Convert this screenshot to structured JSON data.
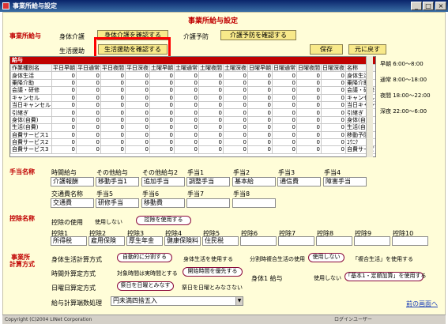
{
  "window": {
    "title": "事業所給与設定"
  },
  "header": {
    "title": "事業所給与設定"
  },
  "kyuyo": {
    "label": "事業所給与",
    "shintai_label": "身体介護",
    "shintai_btn": "身体介護を確認する",
    "kaigo_yobou_label": "介護予防",
    "kaigo_yobou_btn": "介護予防を確認する",
    "seikatsu_label": "生活援助",
    "seikatsu_btn": "生活援助を確認する",
    "save_btn": "保存",
    "restore_btn": "元に戻す"
  },
  "grid": {
    "section_label": "給与",
    "columns": [
      "作業種別名",
      "平日早朝",
      "平日通常",
      "平日夜間",
      "平日深夜",
      "土曜早朝",
      "土曜通常",
      "土曜夜間",
      "土曜深夜",
      "日曜早朝",
      "日曜通常",
      "日曜夜間",
      "日曜深夜",
      "名称"
    ],
    "rows": [
      {
        "name": "身体生活",
        "values": [
          "0",
          "0",
          "0",
          "0",
          "0",
          "0",
          "0",
          "0",
          "0",
          "0",
          "0",
          "0"
        ],
        "alias": "身体生活"
      },
      {
        "name": "乗降介助",
        "values": [
          "0",
          "0",
          "0",
          "0",
          "0",
          "0",
          "0",
          "0",
          "0",
          "0",
          "0",
          "0"
        ],
        "alias": "乗降介助"
      },
      {
        "name": "会議・研修",
        "values": [
          "0",
          "0",
          "0",
          "0",
          "0",
          "0",
          "0",
          "0",
          "0",
          "0",
          "0",
          "0"
        ],
        "alias": "会議・研修"
      },
      {
        "name": "キャンセル",
        "values": [
          "0",
          "0",
          "0",
          "0",
          "0",
          "0",
          "0",
          "0",
          "0",
          "0",
          "0",
          "0"
        ],
        "alias": "キャンセル"
      },
      {
        "name": "当日キャンセル",
        "values": [
          "0",
          "0",
          "0",
          "0",
          "0",
          "0",
          "0",
          "0",
          "0",
          "0",
          "0",
          "0"
        ],
        "alias": "当日キャンセル"
      },
      {
        "name": "引継ぎ",
        "values": [
          "0",
          "0",
          "0",
          "0",
          "0",
          "0",
          "0",
          "0",
          "0",
          "0",
          "0",
          "0"
        ],
        "alias": "引継ぎ"
      },
      {
        "name": "身体(自費)",
        "values": [
          "0",
          "0",
          "0",
          "0",
          "0",
          "0",
          "0",
          "0",
          "0",
          "0",
          "0",
          "0"
        ],
        "alias": "身体(自費)"
      },
      {
        "name": "生活(自費)",
        "values": [
          "0",
          "0",
          "0",
          "0",
          "0",
          "0",
          "0",
          "0",
          "0",
          "0",
          "0",
          "0"
        ],
        "alias": "生活(自費)"
      },
      {
        "name": "自費サービス1",
        "values": [
          "0",
          "0",
          "0",
          "0",
          "0",
          "0",
          "0",
          "0",
          "0",
          "0",
          "0",
          "0"
        ],
        "alias": "移動予防"
      },
      {
        "name": "自費サービス2",
        "values": [
          "0",
          "0",
          "0",
          "0",
          "0",
          "0",
          "0",
          "0",
          "0",
          "0",
          "0",
          "0"
        ],
        "alias": "ｺｳﾆｸ"
      },
      {
        "name": "自費サービス3",
        "values": [
          "0",
          "0",
          "0",
          "0",
          "0",
          "0",
          "0",
          "0",
          "0",
          "0",
          "0",
          "0"
        ],
        "alias": "自費サービ"
      }
    ]
  },
  "times": [
    "早朝 6:00～8:00",
    "通常 8:00～18:00",
    "夜間 18:00～22:00",
    "深夜 22:00～6:00"
  ],
  "teate": {
    "label": "手当名称",
    "row1_labels": [
      "時間給与",
      "その他給与",
      "その他給与2",
      "手当1",
      "手当2",
      "手当3",
      "手当4"
    ],
    "row1_values": [
      "介護報酬",
      "移動手当1",
      "追加手当",
      "調整手当",
      "基本給",
      "通信費",
      "障害手当"
    ],
    "row2_labels": [
      "交通費名称",
      "手当5",
      "手当6",
      "手当7",
      "手当8"
    ],
    "row2_values": [
      "交通費",
      "研修手当",
      "移動費",
      "",
      ""
    ]
  },
  "koujo": {
    "label": "控除名称",
    "use_label": "控除の使用",
    "not_use": "使用しない",
    "use": "控除を使用する",
    "labels": [
      "控除1",
      "控除2",
      "控除3",
      "控除4",
      "控除5",
      "控除6",
      "控除7",
      "控除8",
      "控除9",
      "控除10"
    ],
    "values": [
      "所得税",
      "雇用保険",
      "厚生年金",
      "健康保険料",
      "住民税",
      "",
      "",
      "",
      "",
      ""
    ]
  },
  "keisan": {
    "label1": "事業所",
    "label2": "計算方式",
    "shintai_method_label": "身体生活計算方式",
    "shintai_opt1": "自動的に分割する",
    "shintai_opt2": "身体生活を使用する",
    "bunkatsu_label": "分割時複合生活の使用",
    "bunkatsu_opt1": "使用しない",
    "bunkatsu_opt2": "「複合生活」を使用する",
    "jikangai_label": "時間外算定方式",
    "jikangai_opt1": "対象時間は実時間とする",
    "jikangai_opt2": "開始時間を優先する",
    "shintai1_label": "身体1 給与",
    "shintai1_opt1": "使用しない",
    "shintai1_opt2": "「基本1・定額加算」を使用する",
    "nichiyo_label": "日曜日算定方式",
    "nichiyo_opt1": "祭日を日曜とみなす",
    "nichiyo_opt2": "祭日を日曜とみなさない",
    "hasuu_label": "給与計算端数処理",
    "hasuu_value": "円未満四捨五入",
    "back_link": "前の画面へ"
  },
  "status": {
    "copyright": "Copyright (C)2004 LINet Corporation",
    "login": "ログインユーザー"
  }
}
